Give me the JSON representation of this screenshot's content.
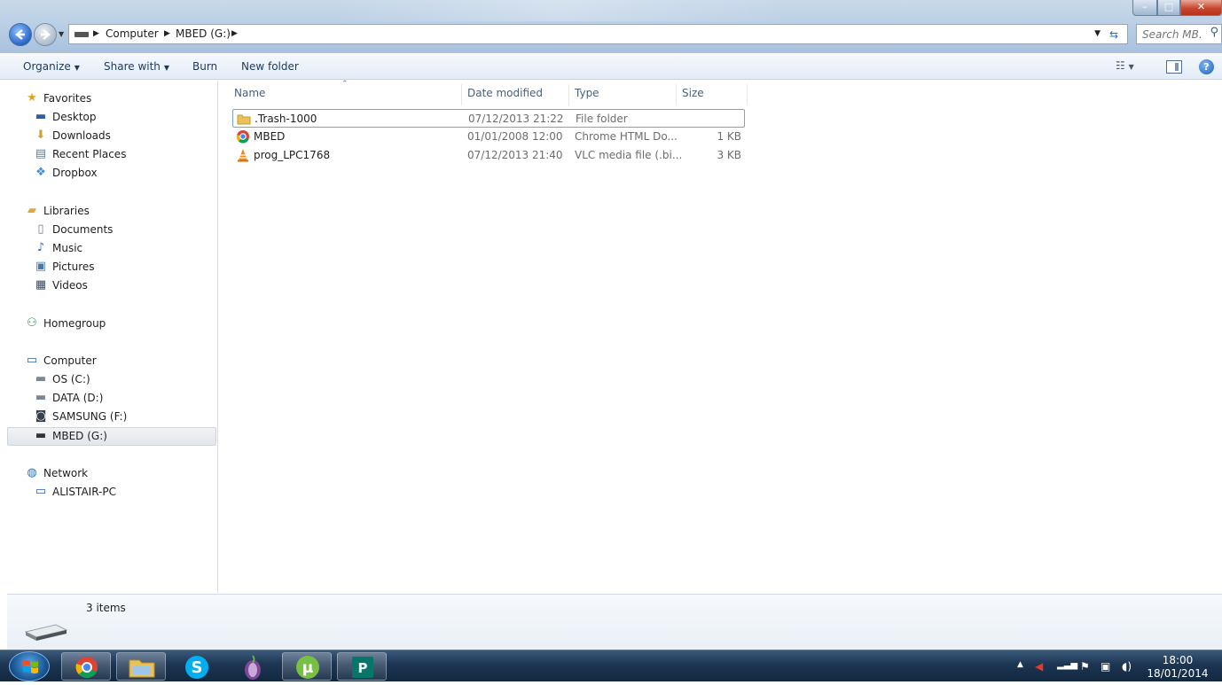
{
  "address": {
    "crumbs": [
      "Computer",
      "MBED (G:)"
    ],
    "search_placeholder": "Search MB..."
  },
  "window_controls": {
    "minimize": "–",
    "maximize": "□",
    "close": "✕"
  },
  "commandbar": {
    "organize": "Organize",
    "share_with": "Share with",
    "burn": "Burn",
    "new_folder": "New folder"
  },
  "nav": {
    "favorites": {
      "label": "Favorites",
      "items": [
        "Desktop",
        "Downloads",
        "Recent Places",
        "Dropbox"
      ]
    },
    "libraries": {
      "label": "Libraries",
      "items": [
        "Documents",
        "Music",
        "Pictures",
        "Videos"
      ]
    },
    "homegroup": {
      "label": "Homegroup"
    },
    "computer": {
      "label": "Computer",
      "items": [
        "OS (C:)",
        "DATA (D:)",
        "SAMSUNG (F:)",
        "MBED (G:)"
      ]
    },
    "network": {
      "label": "Network",
      "items": [
        "ALISTAIR-PC"
      ]
    }
  },
  "columns": {
    "name": "Name",
    "date": "Date modified",
    "type": "Type",
    "size": "Size"
  },
  "files": [
    {
      "name": ".Trash-1000",
      "date": "07/12/2013 21:22",
      "type": "File folder",
      "size": "",
      "icon": "folder-icon"
    },
    {
      "name": "MBED",
      "date": "01/01/2008 12:00",
      "type": "Chrome HTML Do...",
      "size": "1 KB",
      "icon": "chrome-icon"
    },
    {
      "name": "prog_LPC1768",
      "date": "07/12/2013 21:40",
      "type": "VLC media file (.bi...",
      "size": "3 KB",
      "icon": "vlc-icon"
    }
  ],
  "details": {
    "items_count": "3 items"
  },
  "taskbar": {
    "apps": [
      "chrome-icon",
      "explorer-icon",
      "skype-icon",
      "tor-icon",
      "utorrent-icon",
      "publisher-icon"
    ],
    "time": "18:00",
    "date": "18/01/2014"
  },
  "colors": {
    "accent": "#2a66c7",
    "selection_border": "#7da2ce",
    "taskbar": "#1c3552"
  }
}
